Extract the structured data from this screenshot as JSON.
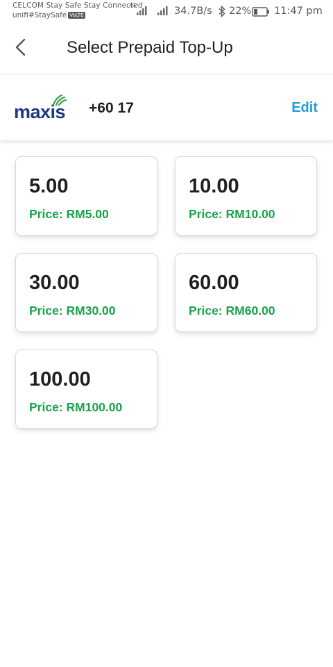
{
  "status_bar": {
    "carrier_line1": "CELCOM Stay Safe Stay Connected",
    "carrier_line2": "unifi#StaySafe",
    "volte": "VoLTE",
    "network_type": "4G⁺",
    "speed": "34.7B/s",
    "battery": "22%",
    "time": "11:47 pm",
    "icons": [
      "signal-icon",
      "signal-icon",
      "bluetooth-icon",
      "battery-icon"
    ]
  },
  "header": {
    "title": "Select Prepaid Top-Up",
    "back_icon": "chevron-left-icon"
  },
  "account": {
    "brand": "maxis",
    "phone": "+60 17",
    "edit_label": "Edit",
    "brand_color": "#1f3a84",
    "brand_accent": "#3aa34a"
  },
  "topups": [
    {
      "amount": "5.00",
      "price": "Price: RM5.00"
    },
    {
      "amount": "10.00",
      "price": "Price: RM10.00"
    },
    {
      "amount": "30.00",
      "price": "Price: RM30.00"
    },
    {
      "amount": "60.00",
      "price": "Price: RM60.00"
    },
    {
      "amount": "100.00",
      "price": "Price: RM100.00"
    }
  ],
  "colors": {
    "price_green": "#1aa34a",
    "edit_blue": "#1da1d6",
    "text_dark": "#1f1f1f"
  }
}
